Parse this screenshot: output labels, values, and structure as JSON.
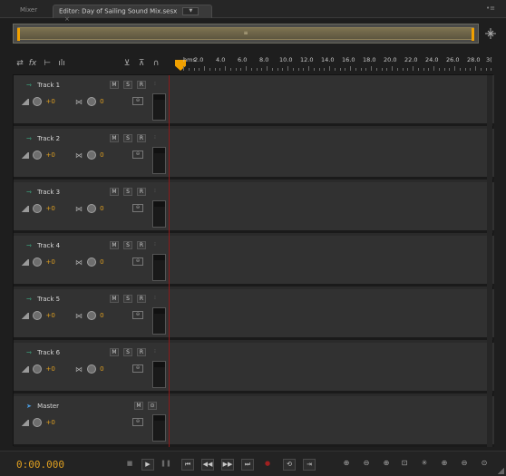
{
  "tabs": {
    "mixer_label": "Mixer",
    "editor_label": "Editor: Day of Sailing Sound Mix.sesx",
    "editor_menu": "▼",
    "editor_close": "×",
    "panel_menu": "•≡"
  },
  "overview": {
    "grip": "≡"
  },
  "toolbar": {
    "icons": [
      "swap-icon",
      "fx-icon",
      "sends-icon",
      "eq-icon",
      "input-monitor-icon",
      "output-icon",
      "headphones-icon"
    ]
  },
  "ruler": {
    "unit": "hms",
    "labels": [
      "2.0",
      "4.0",
      "6.0",
      "8.0",
      "10.0",
      "12.0",
      "14.0",
      "16.0",
      "18.0",
      "20.0",
      "22.0",
      "24.0",
      "26.0",
      "28.0",
      "3("
    ]
  },
  "tracks": [
    {
      "name": "Track 1",
      "volume": "+0",
      "pan": "0"
    },
    {
      "name": "Track 2",
      "volume": "+0",
      "pan": "0"
    },
    {
      "name": "Track 3",
      "volume": "+0",
      "pan": "0"
    },
    {
      "name": "Track 4",
      "volume": "+0",
      "pan": "0"
    },
    {
      "name": "Track 5",
      "volume": "+0",
      "pan": "0"
    },
    {
      "name": "Track 6",
      "volume": "+0",
      "pan": "0"
    }
  ],
  "master": {
    "name": "Master",
    "volume": "+0"
  },
  "track_buttons": {
    "mute": "M",
    "solo": "S",
    "record": "R"
  },
  "transport": {
    "time": "0:00.000",
    "stop": "■",
    "play": "▶",
    "pause": "❚❚",
    "to_start": "⏮",
    "rewind": "◀◀",
    "fast_forward": "▶▶",
    "to_end": "⏭",
    "record": "●",
    "loop": "⟲",
    "skip": "⇥"
  }
}
